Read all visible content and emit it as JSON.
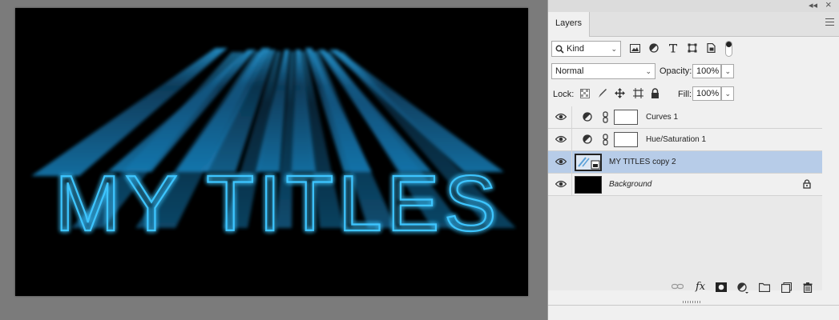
{
  "canvas": {
    "title_text": "MY TITLES",
    "glow_color": "#1aa3e8",
    "background_color": "#000000"
  },
  "panel": {
    "tab_label": "Layers",
    "collapse_glyph": "◂◂",
    "close_glyph": "×",
    "filter": {
      "kind_label": "Kind"
    },
    "blend_mode": "Normal",
    "opacity_label": "Opacity:",
    "opacity_value": "100%",
    "lock_label": "Lock:",
    "fill_label": "Fill:",
    "fill_value": "100%",
    "selected_color": "#b7cce8",
    "layers": [
      {
        "name": "Curves 1",
        "type": "adjustment",
        "icon": "adjustment-icon"
      },
      {
        "name": "Hue/Saturation 1",
        "type": "adjustment",
        "icon": "adjustment-icon"
      },
      {
        "name": "MY TITLES copy 2",
        "type": "smart-object",
        "icon": "smart-object-icon",
        "selected": true
      },
      {
        "name": "Background",
        "type": "background",
        "icon": "lock-icon",
        "locked": true
      }
    ],
    "bottom_icons": [
      "link-layers-icon",
      "fx-icon",
      "add-mask-icon",
      "adjustment-layer-icon",
      "new-group-icon",
      "new-layer-icon",
      "delete-icon"
    ],
    "fx_label": "fx"
  }
}
